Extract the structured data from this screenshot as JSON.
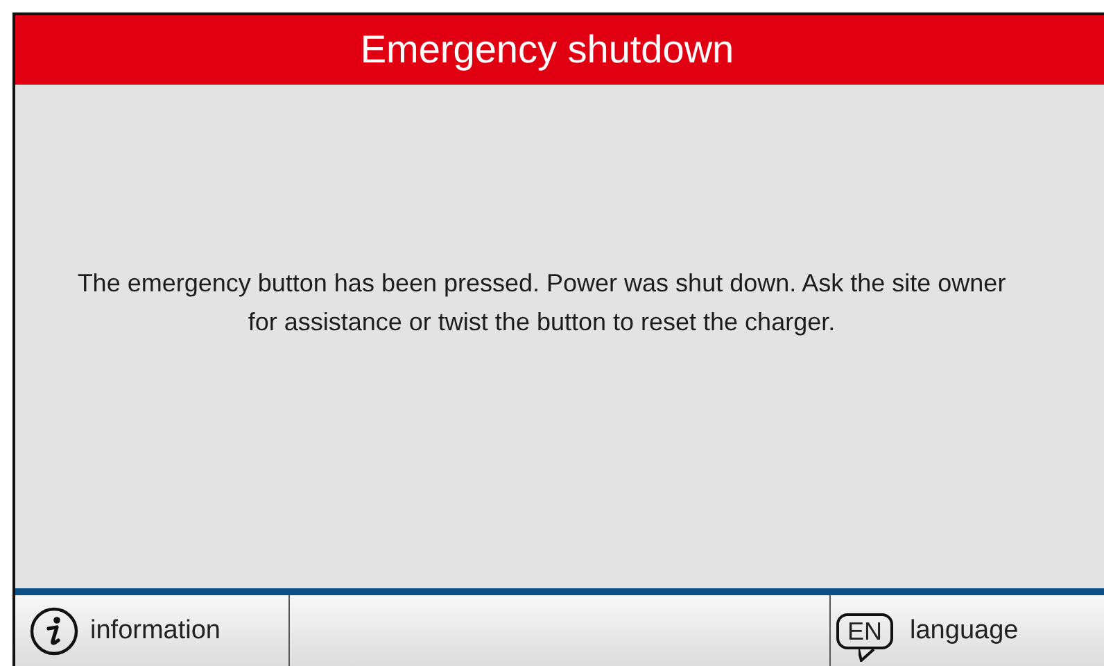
{
  "header": {
    "title": "Emergency shutdown"
  },
  "message": "The emergency button has been pressed. Power was shut down. Ask the site owner for assistance or twist the button to reset the charger.",
  "footer": {
    "buttons": [
      {
        "kind": "info",
        "label": "information"
      },
      {
        "kind": "language",
        "code": "EN",
        "label": "language"
      }
    ]
  }
}
